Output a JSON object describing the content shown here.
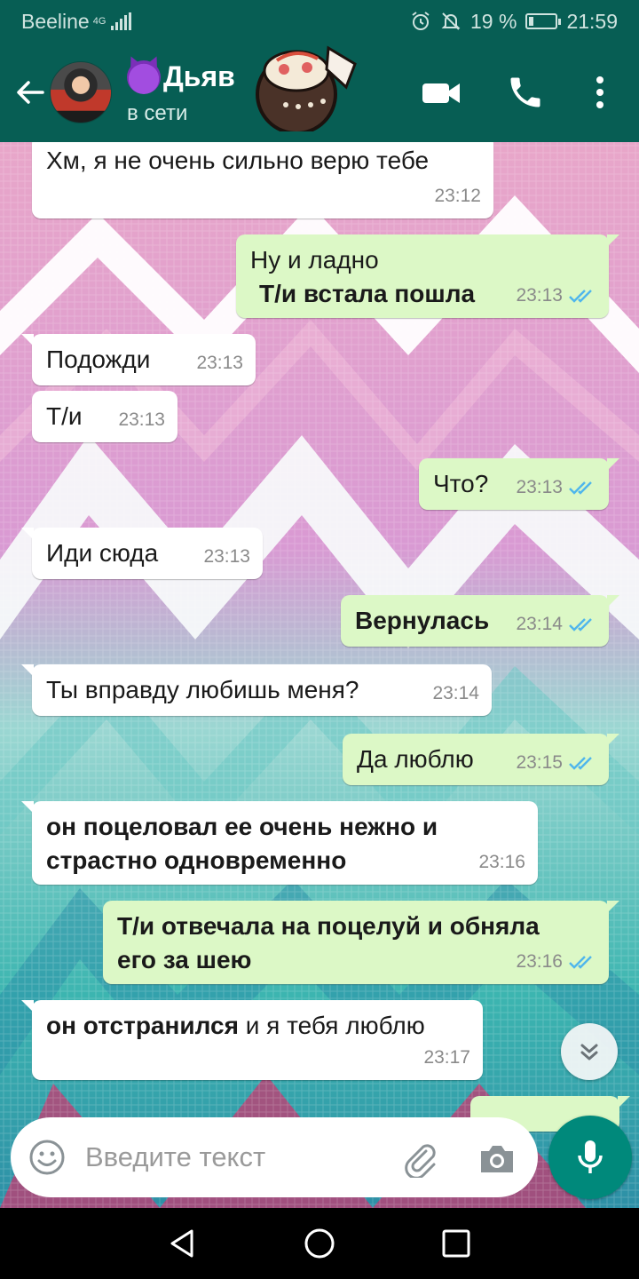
{
  "status_bar": {
    "carrier": "Beeline",
    "network": "4G",
    "battery": "19 %",
    "battery_level": 0.19,
    "time": "21:59"
  },
  "header": {
    "contact_name": "Дьяв",
    "status": "в сети"
  },
  "messages": [
    {
      "dir": "in",
      "text": "Хм, я не очень сильно верю тебе",
      "time": "23:12",
      "bold": false
    },
    {
      "dir": "out",
      "text": "Ну и ладно",
      "text_bold": "Т/и встала пошла",
      "time": "23:13",
      "bold": false
    },
    {
      "dir": "in",
      "text": "Подожди",
      "time": "23:13",
      "bold": false
    },
    {
      "dir": "in",
      "text": "Т/и",
      "time": "23:13",
      "bold": false
    },
    {
      "dir": "out",
      "text": "Что?",
      "time": "23:13",
      "bold": false
    },
    {
      "dir": "in",
      "text": "Иди сюда",
      "time": "23:13",
      "bold": false
    },
    {
      "dir": "out",
      "text": "Вернулась",
      "time": "23:14",
      "bold": true
    },
    {
      "dir": "in",
      "text": "Ты вправду любишь меня?",
      "time": "23:14",
      "bold": false
    },
    {
      "dir": "out",
      "text": "Да люблю",
      "time": "23:15",
      "bold": false
    },
    {
      "dir": "in",
      "text": "он поцеловал ее очень нежно и\nстрастно одновременно",
      "time": "23:16",
      "bold": true
    },
    {
      "dir": "out",
      "text": "Т/и отвечала на поцелуй и обняла\nего за шею",
      "time": "23:16",
      "bold": true
    },
    {
      "dir": "in",
      "text_bold": "он отстранился",
      "text": " и я тебя люблю",
      "time": "23:17",
      "bold": false
    }
  ],
  "input": {
    "placeholder": "Введите текст"
  }
}
